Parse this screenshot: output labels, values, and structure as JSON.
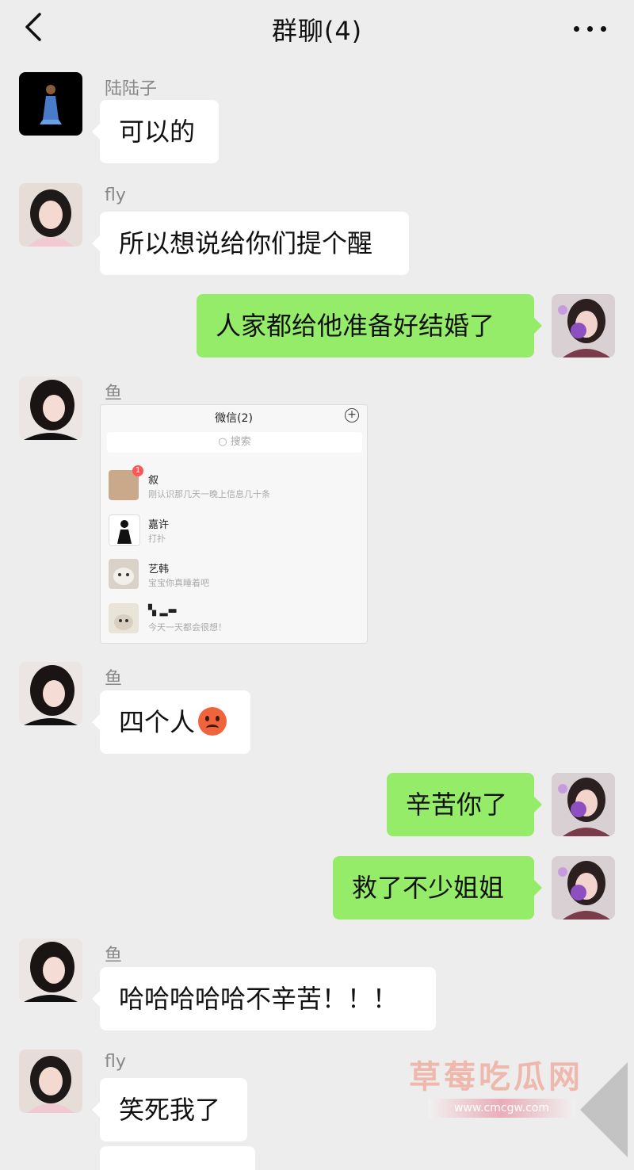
{
  "header": {
    "title": "群聊(4)"
  },
  "messages": [
    {
      "side": "left",
      "sender": "陆陆子",
      "text": "可以的"
    },
    {
      "side": "left",
      "sender": "fly",
      "text": "所以想说给你们提个醒"
    },
    {
      "side": "right",
      "text": "人家都给他准备好结婚了"
    },
    {
      "side": "left",
      "sender": "鱼",
      "type": "image"
    },
    {
      "side": "left",
      "sender": "鱼",
      "text": "四个人"
    },
    {
      "side": "right",
      "text": "辛苦你了"
    },
    {
      "side": "right",
      "text": "救了不少姐姐"
    },
    {
      "side": "left",
      "sender": "鱼",
      "text": "哈哈哈哈哈不辛苦！！！"
    },
    {
      "side": "left",
      "sender": "fly",
      "text": "笑死我了"
    }
  ],
  "screenshot": {
    "title": "微信(2)",
    "search_placeholder": "搜索",
    "chats": [
      {
        "name": "叙",
        "preview": "刚认识那几天一晚上信息几十条",
        "badge": "1"
      },
      {
        "name": "嘉许",
        "preview": "打扑"
      },
      {
        "name": "艺韩",
        "preview": "宝宝你真睡着吧"
      },
      {
        "name": "",
        "preview": "今天一天都会很想！"
      }
    ]
  },
  "watermark": {
    "text": "草莓吃瓜网",
    "url": "www.cmcgw.com"
  },
  "colors": {
    "background": "#ededed",
    "self_bubble": "#95ec69",
    "other_bubble": "#ffffff"
  }
}
